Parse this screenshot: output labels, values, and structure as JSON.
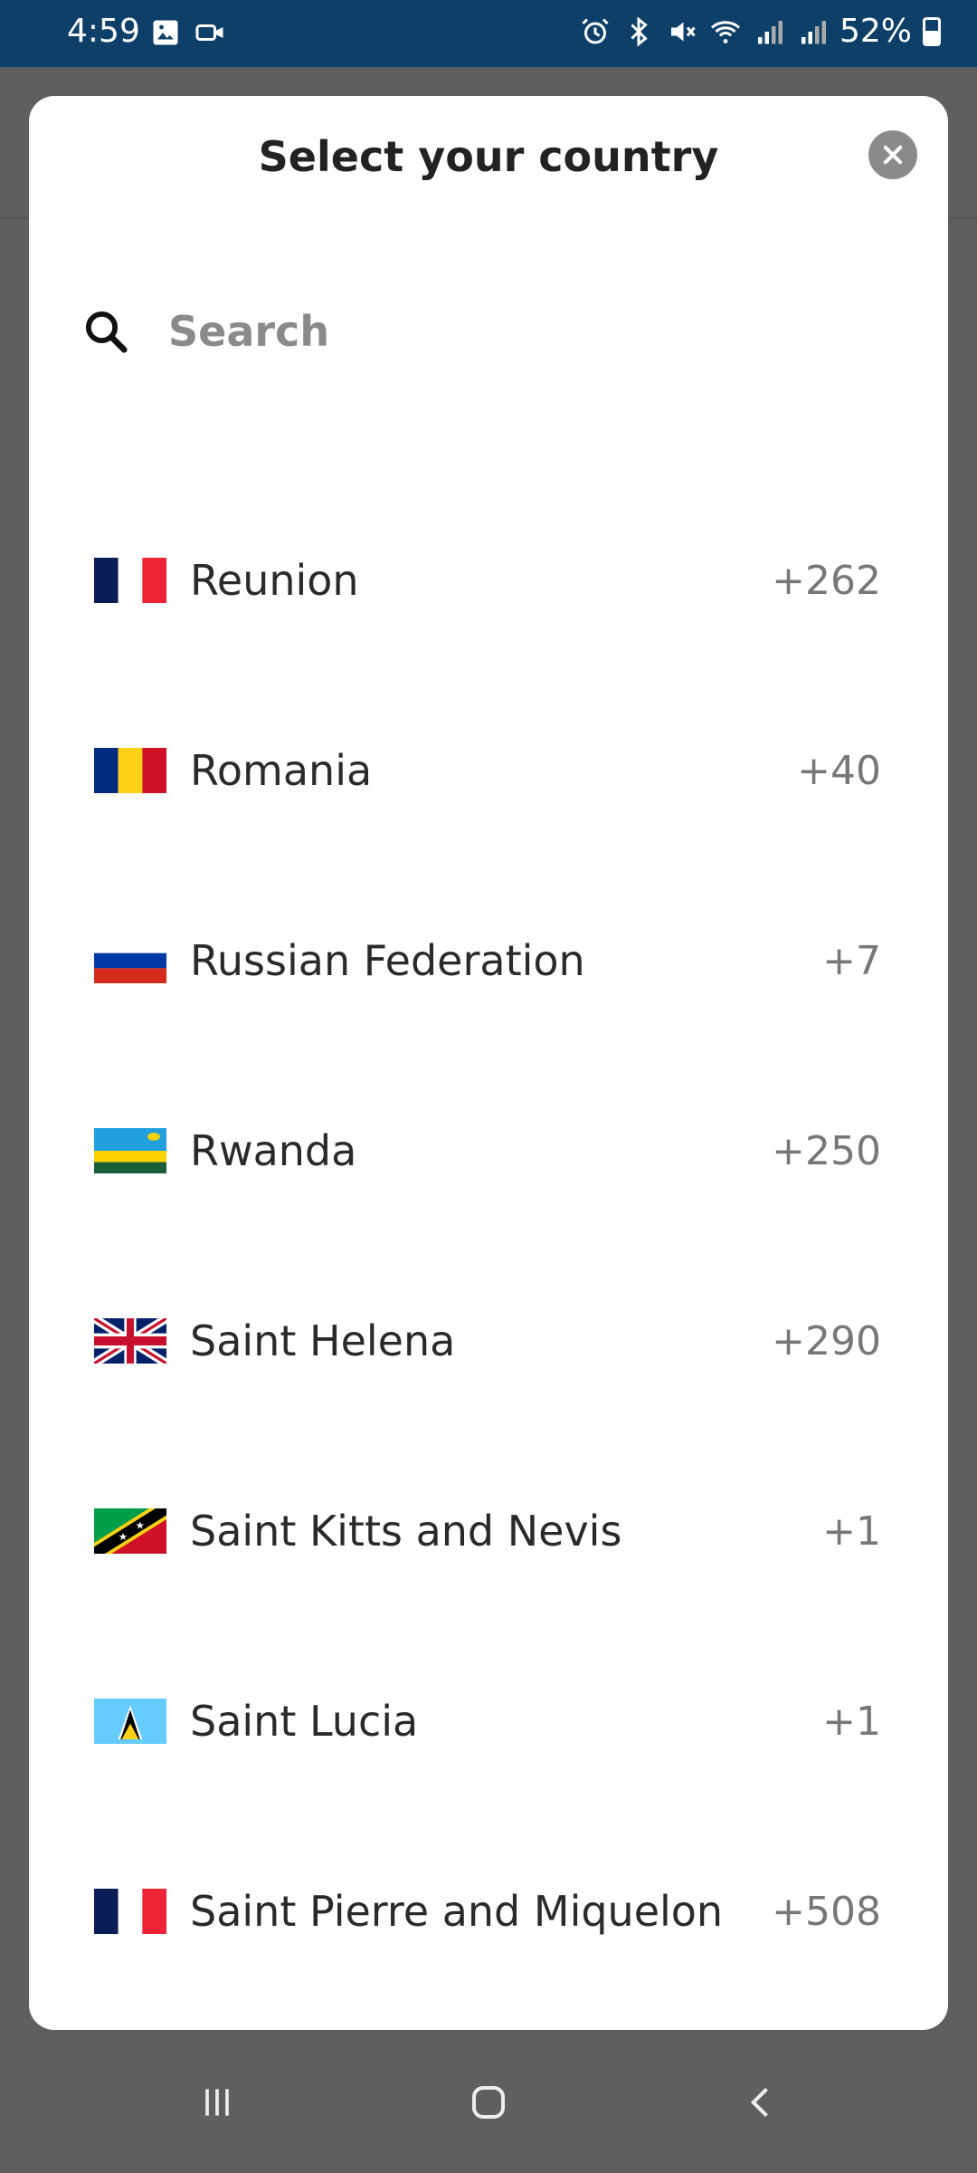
{
  "status_bar": {
    "time": "4:59",
    "battery": "52%",
    "icons": [
      "gallery-icon",
      "video-icon",
      "alarm-icon",
      "bluetooth-icon",
      "mute-icon",
      "wifi-icon",
      "signal-icon",
      "signal-icon",
      "battery-icon"
    ]
  },
  "modal": {
    "title": "Select your country",
    "close_icon": "close-icon",
    "search_placeholder": "Search",
    "search_value": ""
  },
  "countries": [
    {
      "name": "Reunion",
      "code": "+262",
      "flag": "france"
    },
    {
      "name": "Romania",
      "code": "+40",
      "flag": "romania"
    },
    {
      "name": "Russian Federation",
      "code": "+7",
      "flag": "russia"
    },
    {
      "name": "Rwanda",
      "code": "+250",
      "flag": "rwanda"
    },
    {
      "name": "Saint Helena",
      "code": "+290",
      "flag": "uk"
    },
    {
      "name": "Saint Kitts and Nevis",
      "code": "+1",
      "flag": "saint-kitts"
    },
    {
      "name": "Saint Lucia",
      "code": "+1",
      "flag": "saint-lucia"
    },
    {
      "name": "Saint Pierre and Miquelon",
      "code": "+508",
      "flag": "france"
    }
  ],
  "nav": {
    "icons": [
      "recents-icon",
      "home-icon",
      "back-icon"
    ]
  }
}
